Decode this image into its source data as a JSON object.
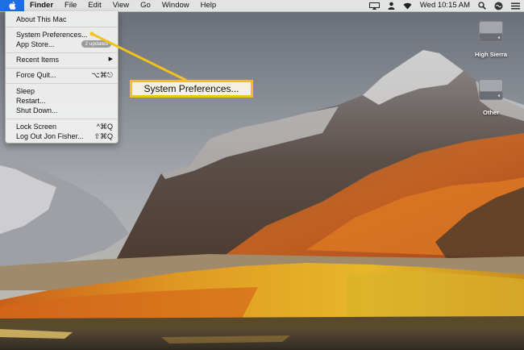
{
  "menubar": {
    "apple_icon": "apple-logo",
    "items": [
      "Finder",
      "File",
      "Edit",
      "View",
      "Go",
      "Window",
      "Help"
    ],
    "status_icons": [
      "airplay-icon",
      "user-icon",
      "wifi-icon"
    ],
    "clock": "Wed 10:15 AM",
    "right_icons": [
      "search-icon",
      "siri-icon",
      "list-icon"
    ]
  },
  "apple_menu": {
    "items": [
      {
        "label": "About This Mac"
      },
      {
        "label": "System Preferences..."
      },
      {
        "label": "App Store...",
        "badge": "2 updates"
      },
      {
        "label": "Recent Items",
        "arrow": "▶"
      },
      {
        "label": "Force Quit...",
        "shortcut": "⌥⌘⎋"
      },
      {
        "label": "Sleep"
      },
      {
        "label": "Restart..."
      },
      {
        "label": "Shut Down..."
      },
      {
        "label": "Lock Screen",
        "shortcut": "^⌘Q"
      },
      {
        "label": "Log Out Jon Fisher...",
        "shortcut": "⇧⌘Q"
      }
    ]
  },
  "callout": {
    "label": "System Preferences...",
    "color": "#f1c21b"
  },
  "desktop_icons": [
    {
      "label": "High Sierra",
      "icon": "hard-drive-icon"
    },
    {
      "label": "Other",
      "icon": "hard-drive-icon"
    }
  ],
  "wallpaper": "mountain landscape at sunset with orange and yellow foliage"
}
